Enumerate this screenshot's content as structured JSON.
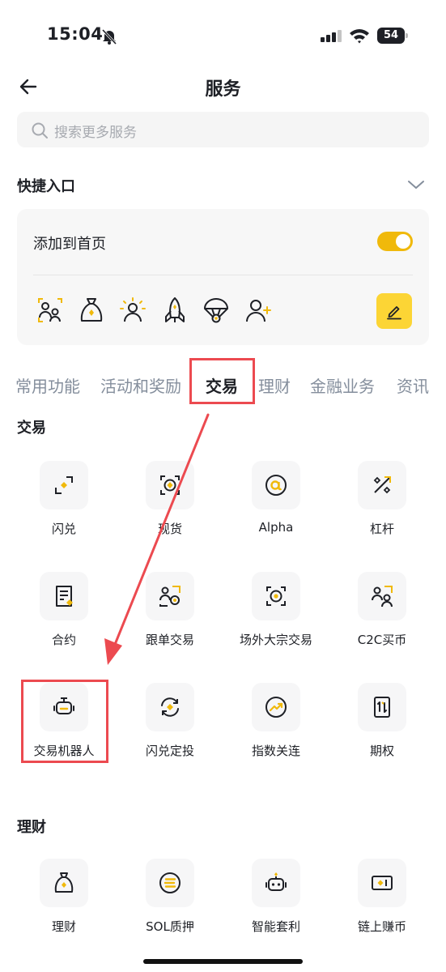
{
  "status_bar": {
    "time": "15:04",
    "battery": "54"
  },
  "header": {
    "title": "服务"
  },
  "search": {
    "placeholder": "搜索更多服务"
  },
  "quick_entry": {
    "title": "快捷入口",
    "add_to_home_label": "添加到首页",
    "toggle_on": true,
    "icons": [
      "copy-trading-icon",
      "earn-bag-icon",
      "sun-user-icon",
      "rocket-icon",
      "parachute-icon",
      "add-user-icon"
    ]
  },
  "tabs": [
    {
      "label": "常用功能",
      "active": false
    },
    {
      "label": "活动和奖励",
      "active": false
    },
    {
      "label": "交易",
      "active": true
    },
    {
      "label": "理财",
      "active": false
    },
    {
      "label": "金融业务",
      "active": false
    },
    {
      "label": "资讯",
      "active": false
    }
  ],
  "sections": [
    {
      "title": "交易",
      "items": [
        {
          "label": "闪兑",
          "icon": "convert-icon"
        },
        {
          "label": "现货",
          "icon": "spot-icon"
        },
        {
          "label": "Alpha",
          "icon": "alpha-icon"
        },
        {
          "label": "杠杆",
          "icon": "margin-icon"
        },
        {
          "label": "合约",
          "icon": "futures-icon"
        },
        {
          "label": "跟单交易",
          "icon": "copy-trading-icon"
        },
        {
          "label": "场外大宗交易",
          "icon": "otc-icon"
        },
        {
          "label": "C2C买币",
          "icon": "c2c-icon"
        },
        {
          "label": "交易机器人",
          "icon": "trading-bot-icon"
        },
        {
          "label": "闪兑定投",
          "icon": "auto-invest-icon"
        },
        {
          "label": "指数关连",
          "icon": "index-link-icon"
        },
        {
          "label": "期权",
          "icon": "options-icon"
        }
      ]
    },
    {
      "title": "理财",
      "items": [
        {
          "label": "理财",
          "icon": "earn-bag-icon"
        },
        {
          "label": "SOL质押",
          "icon": "sol-staking-icon"
        },
        {
          "label": "智能套利",
          "icon": "smart-arbitrage-icon"
        },
        {
          "label": "链上赚币",
          "icon": "onchain-earn-icon"
        }
      ]
    }
  ],
  "colors": {
    "accent": "#F0B90B",
    "highlight": "#EC4A50",
    "text": "#1E2026",
    "muted": "#848E9C"
  }
}
